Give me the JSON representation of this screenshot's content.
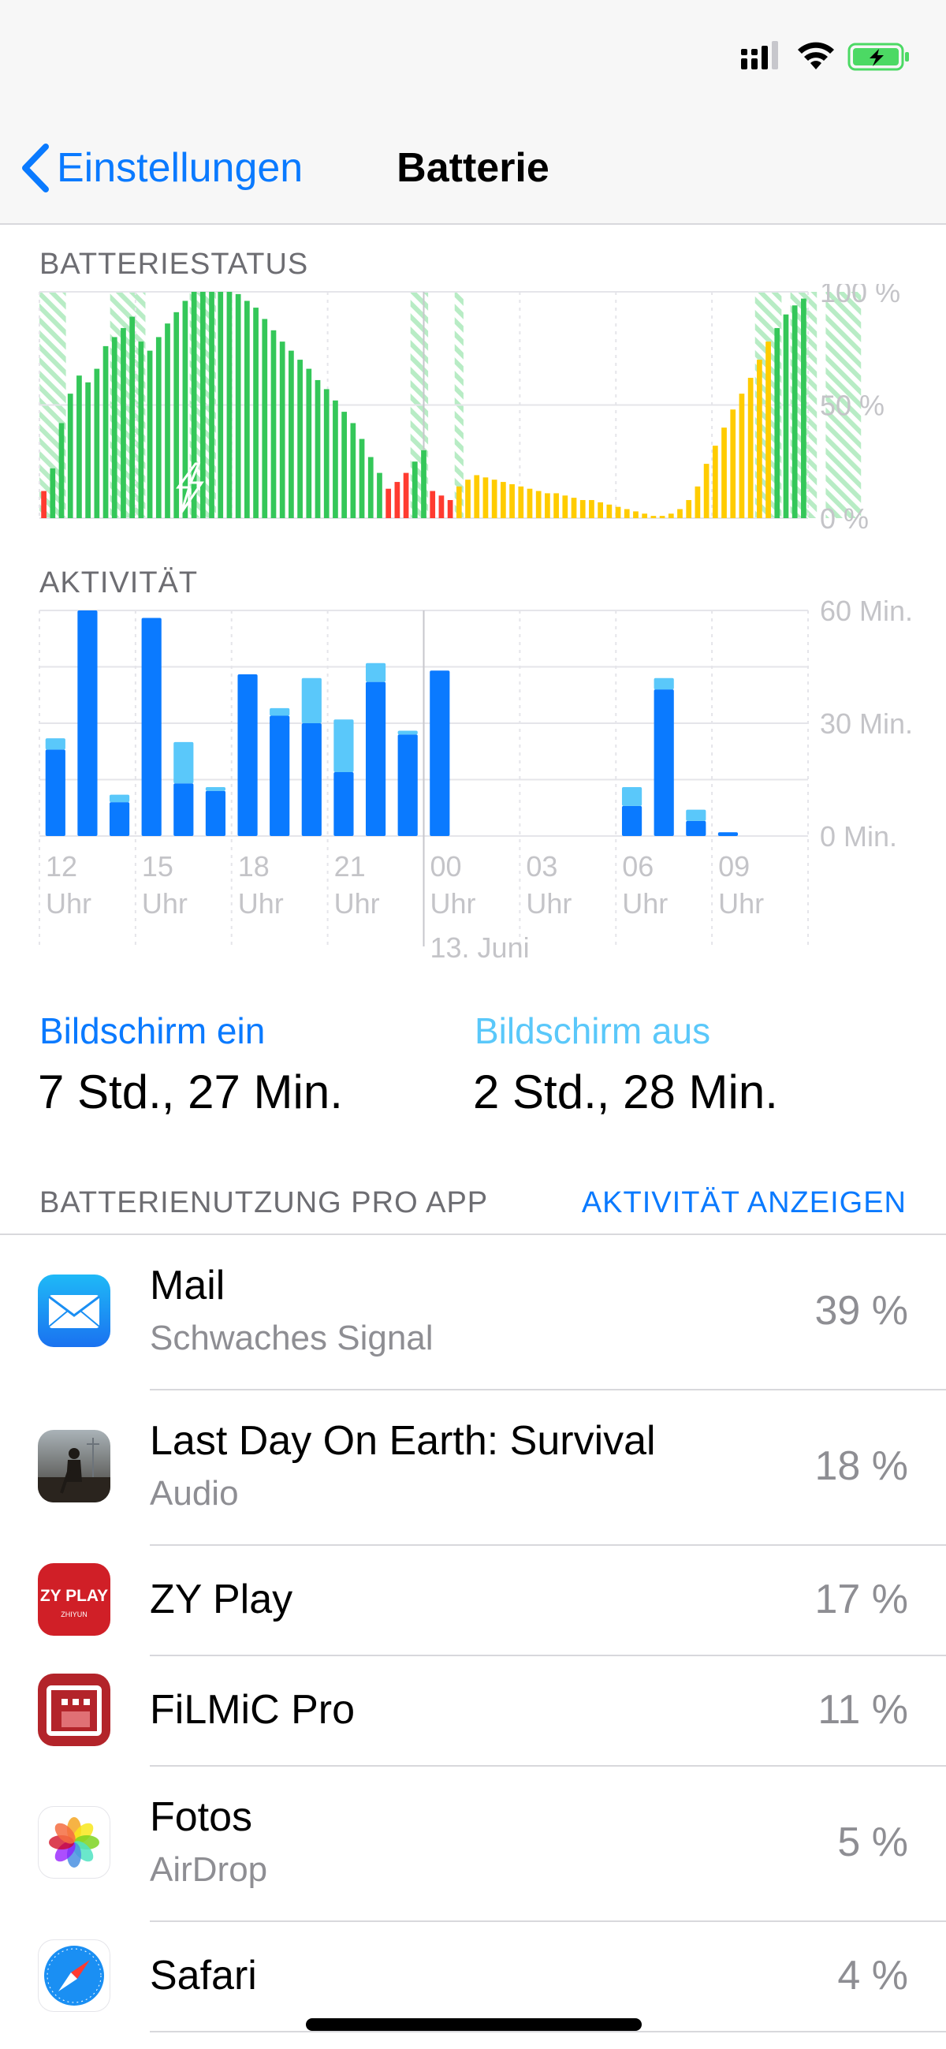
{
  "nav": {
    "back_label": "Einstellungen",
    "title": "Batterie"
  },
  "status_bar": {
    "icons": [
      "signal-icon",
      "wifi-icon",
      "battery-charging-icon"
    ]
  },
  "battery_section": {
    "label": "BATTERIESTATUS",
    "y_ticks": [
      "100 %",
      "50 %",
      "0 %"
    ]
  },
  "activity_section": {
    "label": "AKTIVITÄT",
    "y_ticks": [
      "60 Min.",
      "30 Min.",
      "0 Min."
    ],
    "x_ticks": [
      {
        "hour": "12",
        "unit": "Uhr"
      },
      {
        "hour": "15",
        "unit": "Uhr"
      },
      {
        "hour": "18",
        "unit": "Uhr"
      },
      {
        "hour": "21",
        "unit": "Uhr"
      },
      {
        "hour": "00",
        "unit": "Uhr"
      },
      {
        "hour": "03",
        "unit": "Uhr"
      },
      {
        "hour": "06",
        "unit": "Uhr"
      },
      {
        "hour": "09",
        "unit": "Uhr"
      }
    ],
    "date_label": "13. Juni"
  },
  "chart_data": [
    {
      "type": "bar",
      "title": "BATTERIESTATUS",
      "ylim": [
        0,
        100
      ],
      "y_ticks": [
        "100 %",
        "50 %",
        "0 %"
      ],
      "grid": true,
      "colors": {
        "normal": "#34c759",
        "low": "#ff3b30",
        "low_power": "#ffcc00",
        "charging_band": "#34c759"
      },
      "values": [
        {
          "v": 12,
          "s": "low"
        },
        {
          "v": 22,
          "s": "normal"
        },
        {
          "v": 42,
          "s": "normal"
        },
        {
          "v": 55,
          "s": "normal"
        },
        {
          "v": 63,
          "s": "normal"
        },
        {
          "v": 60,
          "s": "normal"
        },
        {
          "v": 66,
          "s": "normal"
        },
        {
          "v": 76,
          "s": "normal"
        },
        {
          "v": 80,
          "s": "normal"
        },
        {
          "v": 84,
          "s": "normal"
        },
        {
          "v": 89,
          "s": "normal"
        },
        {
          "v": 78,
          "s": "normal"
        },
        {
          "v": 74,
          "s": "normal"
        },
        {
          "v": 80,
          "s": "normal"
        },
        {
          "v": 86,
          "s": "normal"
        },
        {
          "v": 91,
          "s": "normal"
        },
        {
          "v": 96,
          "s": "normal"
        },
        {
          "v": 100,
          "s": "normal"
        },
        {
          "v": 100,
          "s": "normal"
        },
        {
          "v": 100,
          "s": "normal"
        },
        {
          "v": 100,
          "s": "normal"
        },
        {
          "v": 100,
          "s": "normal"
        },
        {
          "v": 99,
          "s": "normal"
        },
        {
          "v": 96,
          "s": "normal"
        },
        {
          "v": 93,
          "s": "normal"
        },
        {
          "v": 88,
          "s": "normal"
        },
        {
          "v": 83,
          "s": "normal"
        },
        {
          "v": 78,
          "s": "normal"
        },
        {
          "v": 74,
          "s": "normal"
        },
        {
          "v": 70,
          "s": "normal"
        },
        {
          "v": 66,
          "s": "normal"
        },
        {
          "v": 61,
          "s": "normal"
        },
        {
          "v": 57,
          "s": "normal"
        },
        {
          "v": 52,
          "s": "normal"
        },
        {
          "v": 47,
          "s": "normal"
        },
        {
          "v": 42,
          "s": "normal"
        },
        {
          "v": 35,
          "s": "normal"
        },
        {
          "v": 27,
          "s": "normal"
        },
        {
          "v": 20,
          "s": "normal"
        },
        {
          "v": 13,
          "s": "low"
        },
        {
          "v": 16,
          "s": "low"
        },
        {
          "v": 20,
          "s": "low"
        },
        {
          "v": 25,
          "s": "normal"
        },
        {
          "v": 30,
          "s": "normal"
        },
        {
          "v": 12,
          "s": "low"
        },
        {
          "v": 10,
          "s": "low"
        },
        {
          "v": 8,
          "s": "low"
        },
        {
          "v": 14,
          "s": "low_power"
        },
        {
          "v": 17,
          "s": "low_power"
        },
        {
          "v": 19,
          "s": "low_power"
        },
        {
          "v": 18,
          "s": "low_power"
        },
        {
          "v": 17,
          "s": "low_power"
        },
        {
          "v": 16,
          "s": "low_power"
        },
        {
          "v": 15,
          "s": "low_power"
        },
        {
          "v": 14,
          "s": "low_power"
        },
        {
          "v": 13,
          "s": "low_power"
        },
        {
          "v": 12,
          "s": "low_power"
        },
        {
          "v": 11,
          "s": "low_power"
        },
        {
          "v": 11,
          "s": "low_power"
        },
        {
          "v": 10,
          "s": "low_power"
        },
        {
          "v": 9,
          "s": "low_power"
        },
        {
          "v": 8,
          "s": "low_power"
        },
        {
          "v": 8,
          "s": "low_power"
        },
        {
          "v": 7,
          "s": "low_power"
        },
        {
          "v": 6,
          "s": "low_power"
        },
        {
          "v": 5,
          "s": "low_power"
        },
        {
          "v": 4,
          "s": "low_power"
        },
        {
          "v": 3,
          "s": "low_power"
        },
        {
          "v": 2,
          "s": "low_power"
        },
        {
          "v": 1,
          "s": "low_power"
        },
        {
          "v": 1,
          "s": "low_power"
        },
        {
          "v": 2,
          "s": "low_power"
        },
        {
          "v": 4,
          "s": "low_power"
        },
        {
          "v": 8,
          "s": "low_power"
        },
        {
          "v": 14,
          "s": "low_power"
        },
        {
          "v": 24,
          "s": "low_power"
        },
        {
          "v": 32,
          "s": "low_power"
        },
        {
          "v": 40,
          "s": "low_power"
        },
        {
          "v": 48,
          "s": "low_power"
        },
        {
          "v": 55,
          "s": "low_power"
        },
        {
          "v": 62,
          "s": "low_power"
        },
        {
          "v": 70,
          "s": "low_power"
        },
        {
          "v": 78,
          "s": "low_power"
        },
        {
          "v": 84,
          "s": "normal"
        },
        {
          "v": 90,
          "s": "normal"
        },
        {
          "v": 94,
          "s": "normal"
        },
        {
          "v": 97,
          "s": "normal"
        }
      ],
      "charging_periods": [
        [
          0,
          3
        ],
        [
          8,
          12
        ],
        [
          17,
          20
        ],
        [
          42,
          44
        ],
        [
          47,
          48
        ],
        [
          81,
          84
        ],
        [
          85,
          88
        ],
        [
          89,
          93
        ]
      ]
    },
    {
      "type": "bar",
      "title": "AKTIVITÄT",
      "ylabel": "Min.",
      "ylim": [
        0,
        60
      ],
      "y_ticks": [
        "60 Min.",
        "30 Min.",
        "0 Min."
      ],
      "categories": [
        "12 Uhr",
        "13",
        "14",
        "15 Uhr",
        "16",
        "17",
        "18 Uhr",
        "19",
        "20",
        "21 Uhr",
        "22",
        "23",
        "00 Uhr",
        "01",
        "02",
        "03 Uhr",
        "04",
        "05",
        "06 Uhr",
        "07",
        "08",
        "09 Uhr",
        "10",
        "11"
      ],
      "stacked": true,
      "series": [
        {
          "name": "Bildschirm ein",
          "color": "#0a7aff",
          "values": [
            23,
            60,
            9,
            58,
            14,
            12,
            43,
            32,
            30,
            17,
            41,
            27,
            44,
            0,
            0,
            0,
            0,
            0,
            8,
            39,
            4,
            1,
            0,
            0
          ]
        },
        {
          "name": "Bildschirm aus",
          "color": "#5ac8fa",
          "values": [
            3,
            0,
            2,
            0,
            11,
            1,
            0,
            2,
            12,
            14,
            5,
            1,
            0,
            0,
            0,
            0,
            0,
            0,
            5,
            3,
            3,
            0,
            0,
            0
          ]
        }
      ]
    }
  ],
  "screen_on": {
    "label": "Bildschirm ein",
    "value": "7 Std., 27 Min.",
    "color": "#0a7aff"
  },
  "screen_off": {
    "label": "Bildschirm aus",
    "value": "2 Std., 28 Min.",
    "color": "#5ac8fa"
  },
  "usage": {
    "header": "BATTERIENUTZUNG PRO APP",
    "link": "AKTIVITÄT ANZEIGEN"
  },
  "apps": [
    {
      "name": "Mail",
      "sub": "Schwaches Signal",
      "pct": "39 %",
      "icon": "mail-icon"
    },
    {
      "name": "Last Day On Earth: Survival",
      "sub": "Audio",
      "pct": "18 %",
      "icon": "last-day-on-earth-icon"
    },
    {
      "name": "ZY Play",
      "sub": "",
      "pct": "17 %",
      "icon": "zy-play-icon",
      "icon_text": "ZY PLAY",
      "icon_subtext": "ZHIYUN"
    },
    {
      "name": "FiLMiC Pro",
      "sub": "",
      "pct": "11 %",
      "icon": "filmic-pro-icon"
    },
    {
      "name": "Fotos",
      "sub": "AirDrop",
      "pct": "5 %",
      "icon": "photos-icon"
    },
    {
      "name": "Safari",
      "sub": "",
      "pct": "4 %",
      "icon": "safari-icon"
    }
  ]
}
